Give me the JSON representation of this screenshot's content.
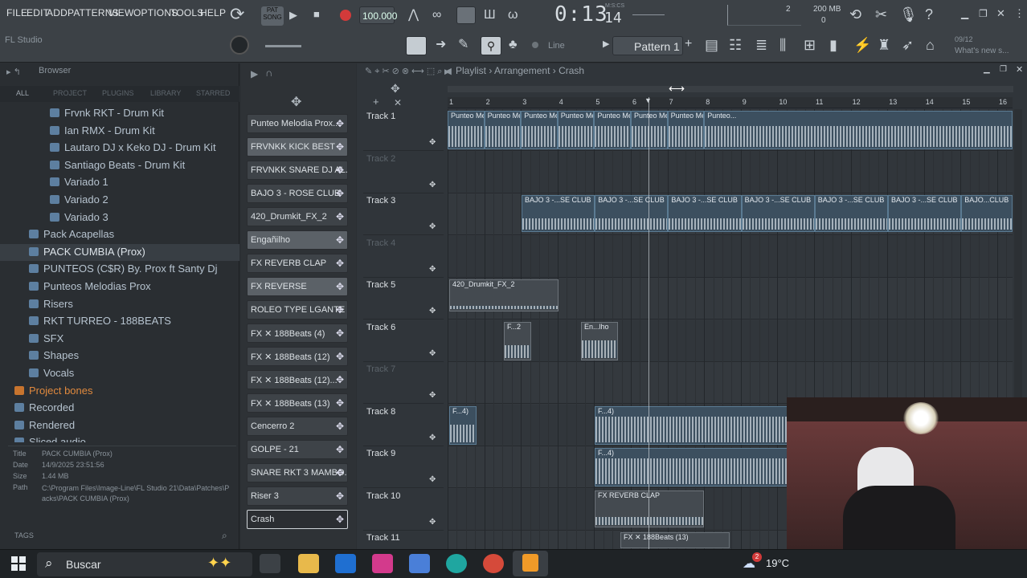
{
  "menu": [
    "FILE",
    "EDIT",
    "ADD",
    "PATTERNS",
    "VIEW",
    "OPTIONS",
    "TOOLS",
    "HELP"
  ],
  "app_hint": "FL Studio",
  "transport": {
    "song_label": "SONG",
    "pat_label": "PAT",
    "tempo": "100.000",
    "time": "0:13",
    "time_small": "14",
    "time_unit": "M:S:CS",
    "cpu_label": "200 MB",
    "cpu_value": "2",
    "poly": "0"
  },
  "toolbar": {
    "snap": "Line",
    "pattern": "Pattern 1",
    "news_date": "09/12",
    "news_text": "What's new s..."
  },
  "browser": {
    "title": "Browser",
    "tabs": [
      "ALL",
      "PROJECT",
      "PLUGINS",
      "LIBRARY",
      "STARRED"
    ],
    "items": [
      {
        "label": "Frvnk RKT - Drum Kit",
        "level": 2
      },
      {
        "label": "Ian RMX - Drum Kit",
        "level": 2
      },
      {
        "label": "Lautaro DJ x Keko DJ - Drum Kit",
        "level": 2
      },
      {
        "label": "Santiago Beats - Drum Kit",
        "level": 2
      },
      {
        "label": "Variado 1",
        "level": 2
      },
      {
        "label": "Variado 2",
        "level": 2
      },
      {
        "label": "Variado 3",
        "level": 2
      },
      {
        "label": "Pack Acapellas",
        "level": 1
      },
      {
        "label": "PACK CUMBIA (Prox)",
        "level": 1,
        "selected": true
      },
      {
        "label": "PUNTEOS (C$R) By. Prox ft Santy Dj",
        "level": 1
      },
      {
        "label": "Punteos Melodias Prox",
        "level": 1
      },
      {
        "label": "Risers",
        "level": 1
      },
      {
        "label": "RKT  TURREO - 188BEATS",
        "level": 1
      },
      {
        "label": "SFX",
        "level": 1
      },
      {
        "label": "Shapes",
        "level": 1
      },
      {
        "label": "Vocals",
        "level": 1
      },
      {
        "label": "Project bones",
        "level": 0,
        "orange": true
      },
      {
        "label": "Recorded",
        "level": 0
      },
      {
        "label": "Rendered",
        "level": 0
      },
      {
        "label": "Sliced audio",
        "level": 0
      }
    ],
    "info": {
      "title_label": "Title",
      "title": "PACK CUMBIA (Prox)",
      "date_label": "Date",
      "date": "14/9/2025 23:51:56",
      "size_label": "Size",
      "size": "1.44 MB",
      "path_label": "Path",
      "path": "C:\\Program Files\\Image-Line\\FL Studio 21\\Data\\Patches\\Packs\\PACK CUMBIA (Prox)"
    },
    "tags_label": "TAGS"
  },
  "channels": [
    {
      "label": "Punteo Melodia Prox..."
    },
    {
      "label": "FRVNKK KICK BEST",
      "hl": true
    },
    {
      "label": "FRVNKK SNARE DJ AL..."
    },
    {
      "label": "BAJO 3 - ROSE CLUB"
    },
    {
      "label": "420_Drumkit_FX_2"
    },
    {
      "label": "Engañilho",
      "hl": true
    },
    {
      "label": "FX REVERB CLAP"
    },
    {
      "label": "FX REVERSE",
      "hl": true
    },
    {
      "label": "ROLEO TYPE LGANTE"
    },
    {
      "label": "FX ✕ 188Beats (4)"
    },
    {
      "label": "FX ✕ 188Beats (12)"
    },
    {
      "label": "FX ✕ 188Beats (12)..."
    },
    {
      "label": "FX ✕ 188Beats (13)"
    },
    {
      "label": "Cencerro 2"
    },
    {
      "label": "GOLPE - 21"
    },
    {
      "label": "SNARE RKT 3 MAMBO..."
    },
    {
      "label": "Riser 3"
    },
    {
      "label": "Crash",
      "sel": true
    }
  ],
  "playlist": {
    "breadcrumb": [
      "Playlist",
      "Arrangement",
      "Crash"
    ],
    "bars": [
      "1",
      "2",
      "3",
      "4",
      "5",
      "6",
      "7",
      "8",
      "9",
      "10",
      "11",
      "12",
      "13",
      "14",
      "15",
      "16"
    ],
    "tracks": [
      {
        "label": "Track 1"
      },
      {
        "label": "Track 2",
        "off": true
      },
      {
        "label": "Track 3"
      },
      {
        "label": "Track 4",
        "off": true
      },
      {
        "label": "Track 5"
      },
      {
        "label": "Track 6"
      },
      {
        "label": "Track 7",
        "off": true
      },
      {
        "label": "Track 8"
      },
      {
        "label": "Track 9"
      },
      {
        "label": "Track 10"
      },
      {
        "label": "Track 11"
      }
    ],
    "clip_labels": {
      "punteo": "Punteo Me...ox (8)",
      "punteo_last": "Punteo...",
      "bajo": "BAJO 3 -...SE CLUB",
      "bajo_last": "BAJO...CLUB",
      "fx420": "420_Drumkit_FX_2",
      "t6a": "F...2",
      "t6b": "En...lho",
      "t8a": "F...4)",
      "reverb": "FX REVERB CLAP",
      "fx13": "FX ✕ 188Beats (13)"
    }
  },
  "taskbar": {
    "search": "Buscar",
    "weather": "19°C",
    "badge": "2"
  }
}
